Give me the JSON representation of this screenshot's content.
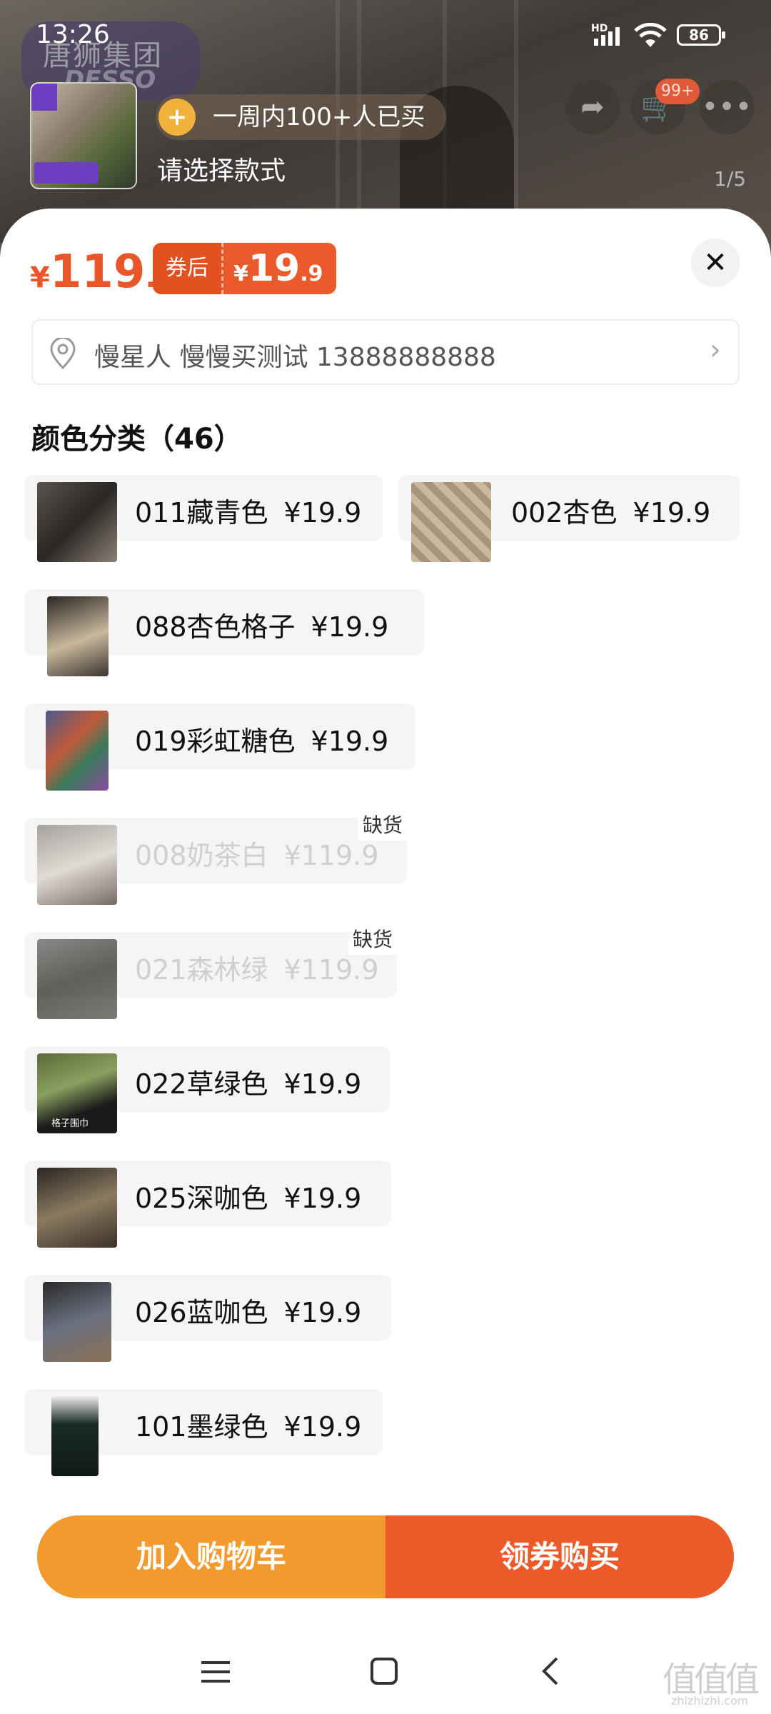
{
  "status_bar": {
    "time": "13:26",
    "network": "HD",
    "battery": "86"
  },
  "background": {
    "brand_text": "唐狮集团",
    "brand_sub": "DESSO"
  },
  "header": {
    "buyers_text": "一周内100+人已买",
    "select_prompt": "请选择款式",
    "cart_badge": "99+",
    "page_indicator": "1/5"
  },
  "price": {
    "symbol": "¥",
    "original_int": "119",
    "original_dec": ".9",
    "coupon_label": "券后",
    "after_int": "19",
    "after_dec": ".9"
  },
  "address": {
    "text": "慢星人 慢慢买测试 13888888888"
  },
  "section": {
    "title": "颜色分类（46）"
  },
  "skus": [
    {
      "name": "011藏青色",
      "price": "¥19.9",
      "available": true
    },
    {
      "name": "002杏色",
      "price": "¥19.9",
      "available": true
    },
    {
      "name": "088杏色格子",
      "price": "¥19.9",
      "available": true
    },
    {
      "name": "019彩虹糖色",
      "price": "¥19.9",
      "available": true
    },
    {
      "name": "008奶茶白",
      "price": "¥119.9",
      "available": false,
      "badge": "缺货"
    },
    {
      "name": "021森林绿",
      "price": "¥119.9",
      "available": false,
      "badge": "缺货"
    },
    {
      "name": "022草绿色",
      "price": "¥19.9",
      "available": true
    },
    {
      "name": "025深咖色",
      "price": "¥19.9",
      "available": true
    },
    {
      "name": "026蓝咖色",
      "price": "¥19.9",
      "available": true
    },
    {
      "name": "101墨绿色",
      "price": "¥19.9",
      "available": true
    }
  ],
  "thumbnail_texts": {
    "sku_022_line1": "格子围巾"
  },
  "buttons": {
    "add_to_cart": "加入购物车",
    "buy_with_coupon": "领券购买"
  },
  "watermark": {
    "main": "值值值",
    "sub": "zhizhizhi.com"
  },
  "colors": {
    "accent_orange": "#ed5a2a",
    "cart_orange": "#f29a2e",
    "price_red": "#e8562a"
  }
}
